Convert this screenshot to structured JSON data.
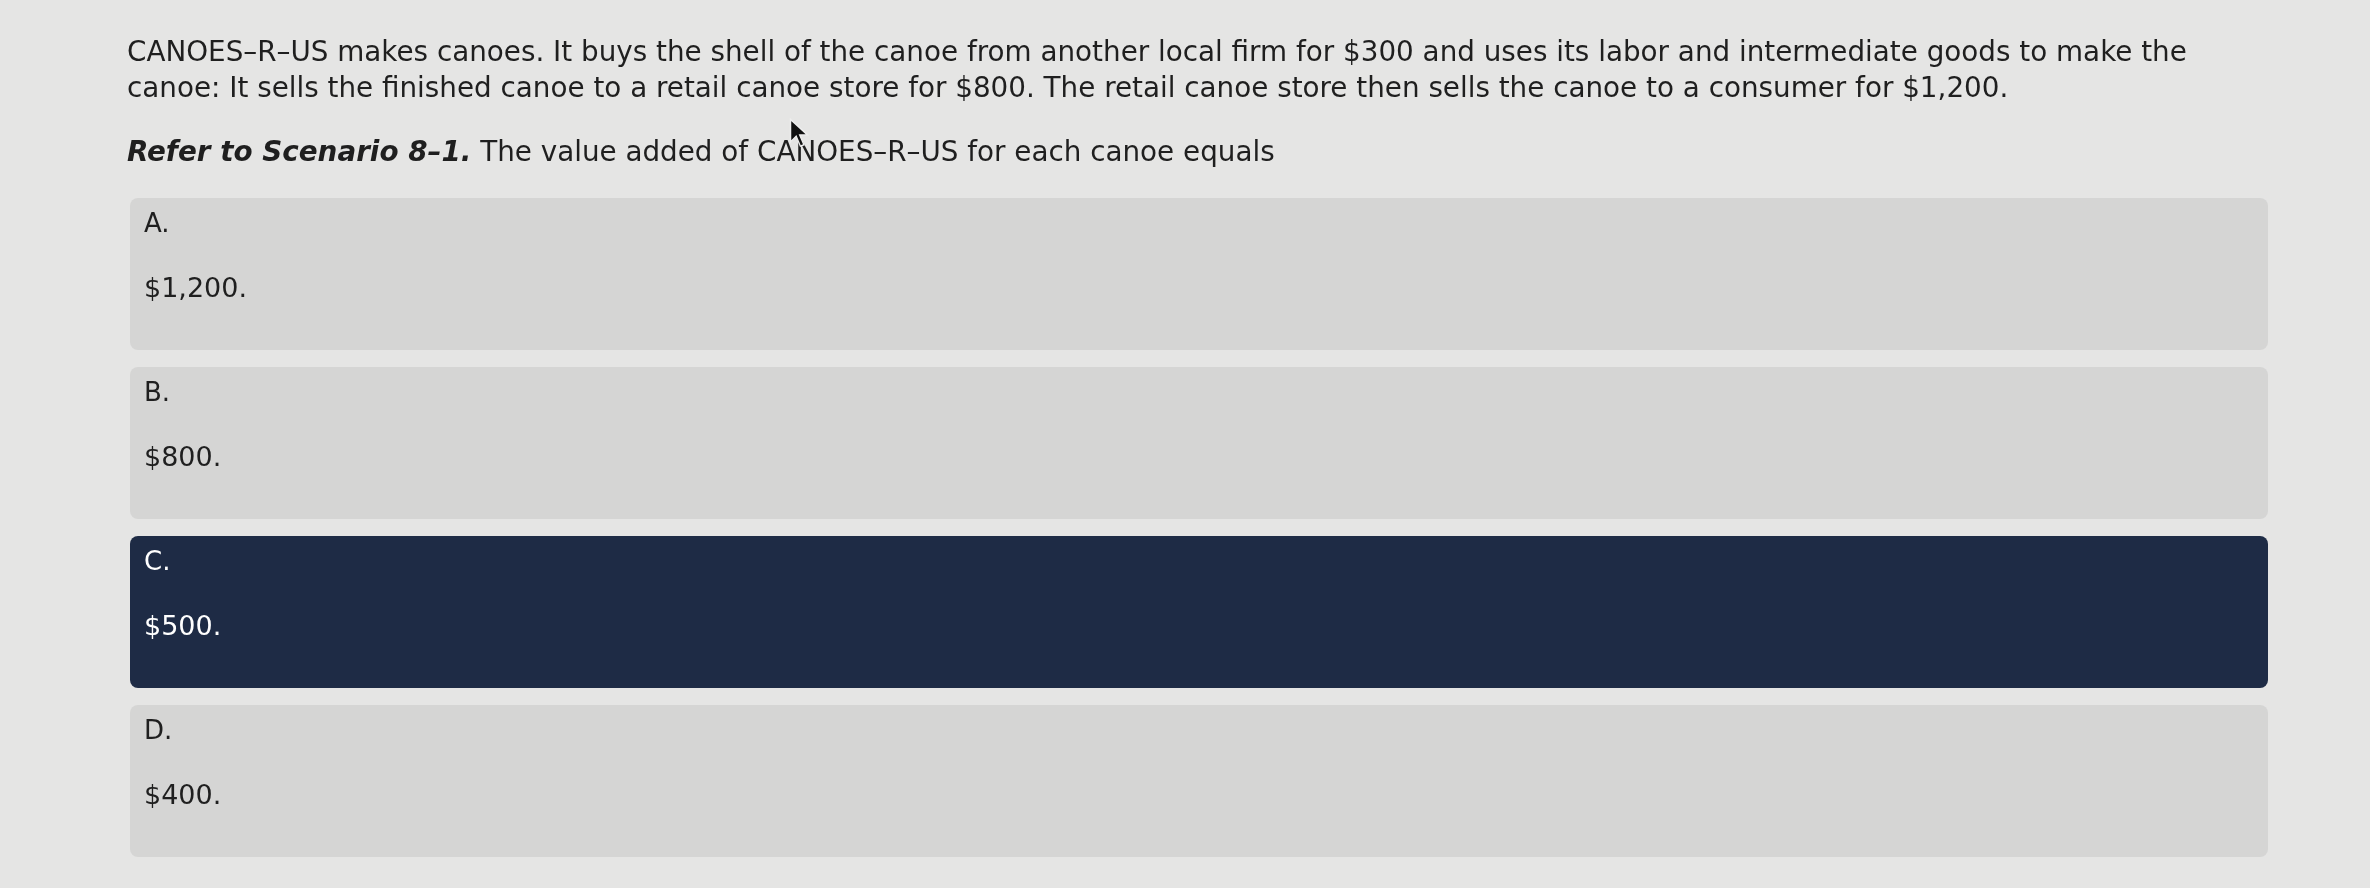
{
  "question": {
    "scenario": "CANOES–R–US makes canoes. It buys the shell of the canoe from another local firm for $300 and uses its labor and intermediate goods to make the canoe: It sells the finished canoe to a retail canoe store for $800. The retail canoe store then sells the canoe to a consumer for $1,200.",
    "prompt": "**Refer to Scenario 8–1.** The value added of CANOES–R–US for each canoe equals"
  },
  "options": [
    {
      "letter": "A.",
      "text": "$1,200.",
      "selected": false
    },
    {
      "letter": "B.",
      "text": "$800.",
      "selected": false
    },
    {
      "letter": "C.",
      "text": "$500.",
      "selected": true
    },
    {
      "letter": "D.",
      "text": "$400.",
      "selected": false
    }
  ]
}
